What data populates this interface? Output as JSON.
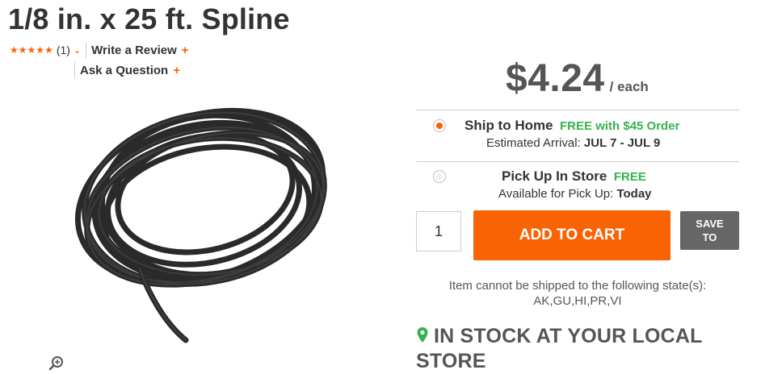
{
  "product": {
    "title": "1/8 in. x 25 ft. Spline",
    "rating_count": "(1)",
    "write_review": "Write a Review",
    "ask_question": "Ask a Question",
    "plus": "+"
  },
  "colors": {
    "accent": "#f96302",
    "free": "#37b24d",
    "text": "#333333",
    "muted": "#555555",
    "save_button": "#666666"
  },
  "pricing": {
    "price": "$4.24",
    "unit": "/ each"
  },
  "fulfillment": {
    "ship": {
      "title": "Ship to Home",
      "free": "FREE with $45 Order",
      "sub_label": "Estimated Arrival:",
      "sub_value": "JUL 7 - JUL 9"
    },
    "pickup": {
      "title": "Pick Up In Store",
      "free": "FREE",
      "sub_label": "Available for Pick Up:",
      "sub_value": "Today"
    }
  },
  "cart": {
    "quantity": "1",
    "add_label": "ADD TO CART",
    "save_line1": "SAVE",
    "save_line2": "TO"
  },
  "shipping_note": {
    "line1": "Item cannot be shipped to the following state(s):",
    "line2": "AK,GU,HI,PR,VI"
  },
  "stock": {
    "line1": "IN STOCK AT YOUR LOCAL",
    "line2": "STORE"
  },
  "icons": [
    "star-icon",
    "chevron-down-icon",
    "plus-icon",
    "zoom-icon",
    "location-pin-icon"
  ]
}
